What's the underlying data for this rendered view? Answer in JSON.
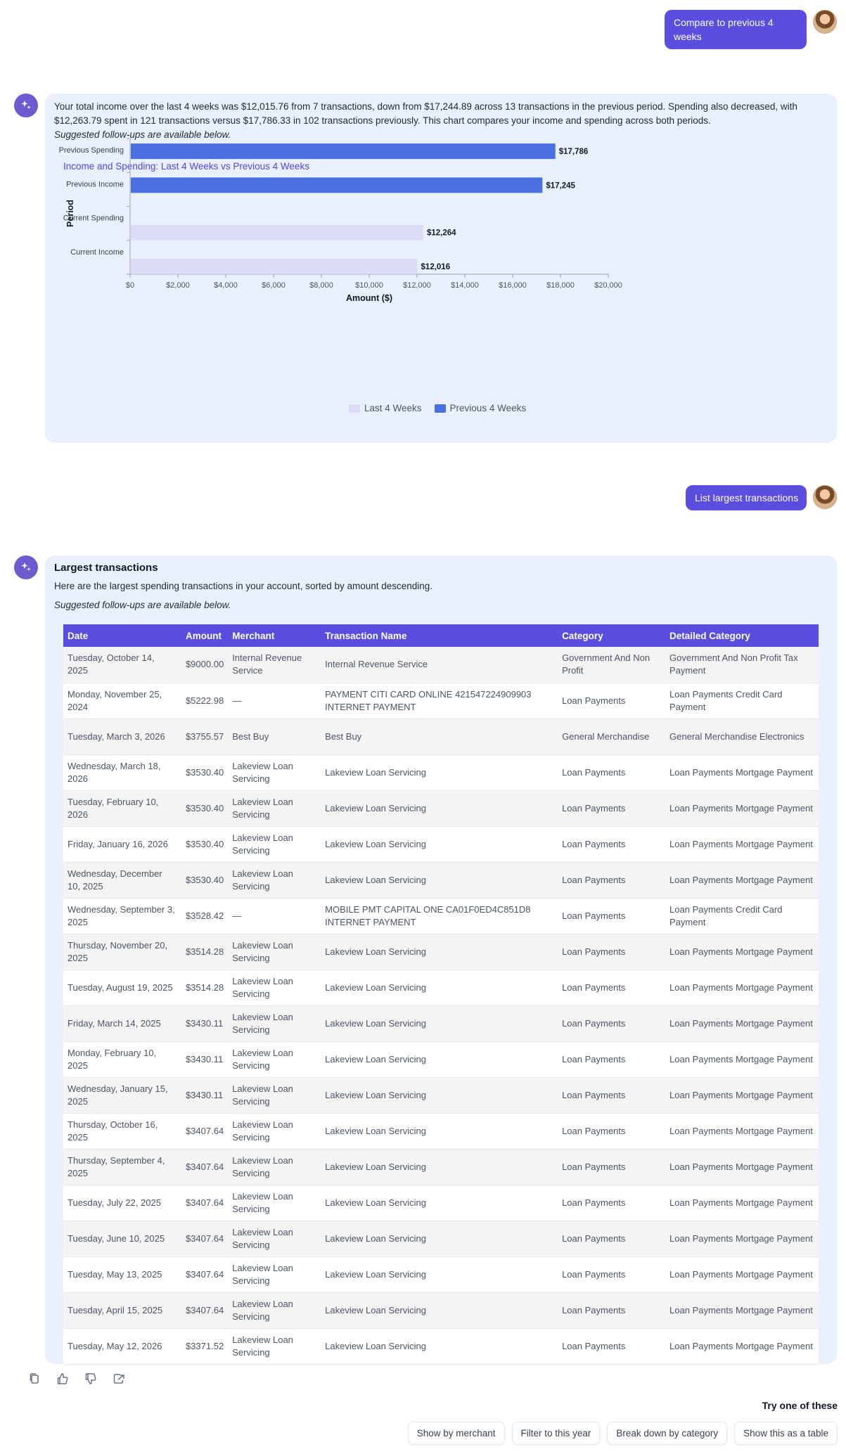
{
  "msg1": {
    "user_text": "Compare to previous 4 weeks",
    "summary": "Your total income over the last 4 weeks was $12,015.76 from 7 transactions, down from $17,244.89 across 13 transactions in the previous period. Spending also decreased, with $12,263.79 spent in 121 transactions versus $17,786.33 in 102 transactions previously. This chart compares your income and spending across both periods.",
    "followups_note": "Suggested follow-ups are available below."
  },
  "chart_data": {
    "type": "bar",
    "orientation": "horizontal",
    "title": "Income and Spending: Last 4 Weeks vs Previous 4 Weeks",
    "xlabel": "Amount ($)",
    "ylabel": "Period",
    "categories": [
      "Previous Spending",
      "Previous Income",
      "Current Spending",
      "Current Income"
    ],
    "values": [
      17786,
      17245,
      12264,
      12016
    ],
    "value_labels": [
      "$17,786",
      "$17,245",
      "$12,264",
      "$12,016"
    ],
    "bar_series": [
      "Previous 4 Weeks",
      "Previous 4 Weeks",
      "Last 4 Weeks",
      "Last 4 Weeks"
    ],
    "xlim": [
      0,
      20000
    ],
    "xticks": [
      "$0",
      "$2,000",
      "$4,000",
      "$6,000",
      "$8,000",
      "$10,000",
      "$12,000",
      "$14,000",
      "$16,000",
      "$18,000",
      "$20,000"
    ],
    "legend": [
      {
        "name": "Last 4 Weeks",
        "color": "#dcdcf7"
      },
      {
        "name": "Previous 4 Weeks",
        "color": "#4a6fe0"
      }
    ],
    "legend_position": "bottom",
    "grid": false
  },
  "msg2": {
    "user_text": "List largest transactions",
    "heading": "Largest transactions",
    "intro": "Here are the largest spending transactions in your account, sorted by amount descending.",
    "followups_note": "Suggested follow-ups are available below."
  },
  "table": {
    "columns": [
      "Date",
      "Amount",
      "Merchant",
      "Transaction Name",
      "Category",
      "Detailed Category"
    ],
    "rows": [
      [
        "Tuesday, October 14, 2025",
        "$9000.00",
        "Internal Revenue Service",
        "Internal Revenue Service",
        "Government And Non Profit",
        "Government And Non Profit Tax Payment"
      ],
      [
        "Monday, November 25, 2024",
        "$5222.98",
        "—",
        "PAYMENT CITI CARD ONLINE 421547224909903 INTERNET PAYMENT",
        "Loan Payments",
        "Loan Payments Credit Card Payment"
      ],
      [
        "Tuesday, March 3, 2026",
        "$3755.57",
        "Best Buy",
        "Best Buy",
        "General Merchandise",
        "General Merchandise Electronics"
      ],
      [
        "Wednesday, March 18, 2026",
        "$3530.40",
        "Lakeview Loan Servicing",
        "Lakeview Loan Servicing",
        "Loan Payments",
        "Loan Payments Mortgage Payment"
      ],
      [
        "Tuesday, February 10, 2026",
        "$3530.40",
        "Lakeview Loan Servicing",
        "Lakeview Loan Servicing",
        "Loan Payments",
        "Loan Payments Mortgage Payment"
      ],
      [
        "Friday, January 16, 2026",
        "$3530.40",
        "Lakeview Loan Servicing",
        "Lakeview Loan Servicing",
        "Loan Payments",
        "Loan Payments Mortgage Payment"
      ],
      [
        "Wednesday, December 10, 2025",
        "$3530.40",
        "Lakeview Loan Servicing",
        "Lakeview Loan Servicing",
        "Loan Payments",
        "Loan Payments Mortgage Payment"
      ],
      [
        "Wednesday, September 3, 2025",
        "$3528.42",
        "—",
        "MOBILE PMT CAPITAL ONE CA01F0ED4C851D8 INTERNET PAYMENT",
        "Loan Payments",
        "Loan Payments Credit Card Payment"
      ],
      [
        "Thursday, November 20, 2025",
        "$3514.28",
        "Lakeview Loan Servicing",
        "Lakeview Loan Servicing",
        "Loan Payments",
        "Loan Payments Mortgage Payment"
      ],
      [
        "Tuesday, August 19, 2025",
        "$3514.28",
        "Lakeview Loan Servicing",
        "Lakeview Loan Servicing",
        "Loan Payments",
        "Loan Payments Mortgage Payment"
      ],
      [
        "Friday, March 14, 2025",
        "$3430.11",
        "Lakeview Loan Servicing",
        "Lakeview Loan Servicing",
        "Loan Payments",
        "Loan Payments Mortgage Payment"
      ],
      [
        "Monday, February 10, 2025",
        "$3430.11",
        "Lakeview Loan Servicing",
        "Lakeview Loan Servicing",
        "Loan Payments",
        "Loan Payments Mortgage Payment"
      ],
      [
        "Wednesday, January 15, 2025",
        "$3430.11",
        "Lakeview Loan Servicing",
        "Lakeview Loan Servicing",
        "Loan Payments",
        "Loan Payments Mortgage Payment"
      ],
      [
        "Thursday, October 16, 2025",
        "$3407.64",
        "Lakeview Loan Servicing",
        "Lakeview Loan Servicing",
        "Loan Payments",
        "Loan Payments Mortgage Payment"
      ],
      [
        "Thursday, September 4, 2025",
        "$3407.64",
        "Lakeview Loan Servicing",
        "Lakeview Loan Servicing",
        "Loan Payments",
        "Loan Payments Mortgage Payment"
      ],
      [
        "Tuesday, July 22, 2025",
        "$3407.64",
        "Lakeview Loan Servicing",
        "Lakeview Loan Servicing",
        "Loan Payments",
        "Loan Payments Mortgage Payment"
      ],
      [
        "Tuesday, June 10, 2025",
        "$3407.64",
        "Lakeview Loan Servicing",
        "Lakeview Loan Servicing",
        "Loan Payments",
        "Loan Payments Mortgage Payment"
      ],
      [
        "Tuesday, May 13, 2025",
        "$3407.64",
        "Lakeview Loan Servicing",
        "Lakeview Loan Servicing",
        "Loan Payments",
        "Loan Payments Mortgage Payment"
      ],
      [
        "Tuesday, April 15, 2025",
        "$3407.64",
        "Lakeview Loan Servicing",
        "Lakeview Loan Servicing",
        "Loan Payments",
        "Loan Payments Mortgage Payment"
      ],
      [
        "Tuesday, May 12, 2026",
        "$3371.52",
        "Lakeview Loan Servicing",
        "Lakeview Loan Servicing",
        "Loan Payments",
        "Loan Payments Mortgage Payment"
      ]
    ]
  },
  "actions": {
    "icons": [
      "copy-icon",
      "thumbs-up-icon",
      "thumbs-down-icon",
      "share-icon"
    ]
  },
  "suggestions": {
    "title": "Try one of these",
    "chips": [
      "Show by merchant",
      "Filter to this year",
      "Break down by category",
      "Show this as a table"
    ]
  },
  "colors": {
    "accent": "#5b4de0",
    "card_bg": "#e9f0fc",
    "bar_previous": "#4a6fe0",
    "bar_current": "#dcdcf7"
  }
}
